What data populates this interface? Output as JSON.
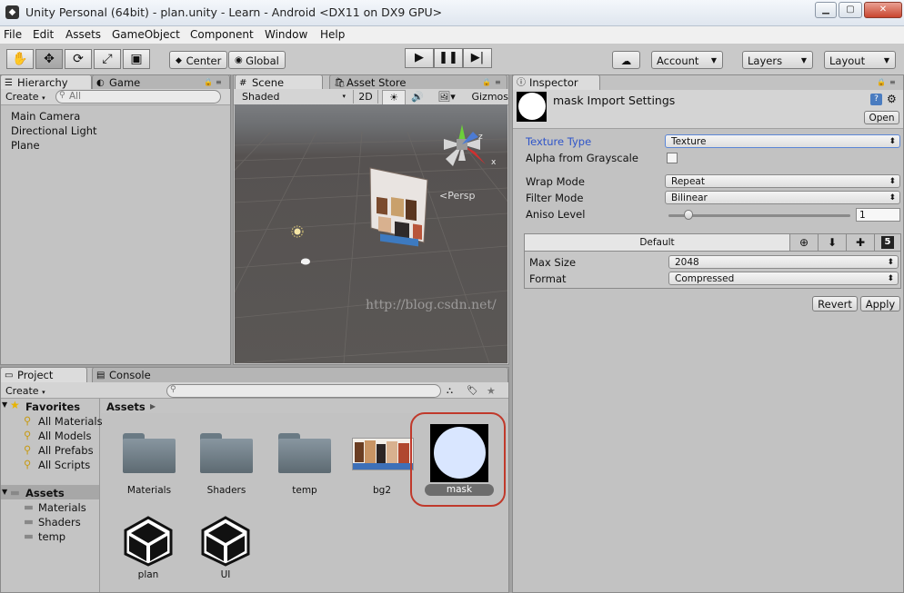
{
  "window": {
    "title": "Unity Personal (64bit) - plan.unity - Learn - Android <DX11 on DX9 GPU>"
  },
  "menu": [
    "File",
    "Edit",
    "Assets",
    "GameObject",
    "Component",
    "Window",
    "Help"
  ],
  "toolbar": {
    "pivot_label": "Center",
    "space_label": "Global",
    "account_label": "Account",
    "layers_label": "Layers",
    "layout_label": "Layout"
  },
  "hierarchy": {
    "tab": "Hierarchy",
    "create_label": "Create",
    "search_placeholder": "All",
    "items": [
      "Main Camera",
      "Directional Light",
      "Plane"
    ]
  },
  "scene": {
    "tabs": [
      "Scene",
      "Game",
      "Asset Store"
    ],
    "shading_mode": "Shaded",
    "mode_2d": "2D",
    "gizmos_label": "Gizmos",
    "persp_label": "Persp",
    "axis_labels": {
      "z": "z",
      "x": "x"
    },
    "watermark": "http://blog.csdn.net/"
  },
  "project": {
    "tabs": [
      "Project",
      "Console"
    ],
    "create_label": "Create",
    "favorites_label": "Favorites",
    "favorites": [
      "All Materials",
      "All Models",
      "All Prefabs",
      "All Scripts"
    ],
    "assets_root": "Assets",
    "asset_folders": [
      "Materials",
      "Shaders",
      "temp"
    ],
    "breadcrumb": "Assets",
    "grid": [
      {
        "name": "Materials",
        "kind": "folder"
      },
      {
        "name": "Shaders",
        "kind": "folder"
      },
      {
        "name": "temp",
        "kind": "folder"
      },
      {
        "name": "bg2",
        "kind": "image"
      },
      {
        "name": "mask",
        "kind": "texture",
        "selected": true
      },
      {
        "name": "plan",
        "kind": "unity-scene"
      },
      {
        "name": "UI",
        "kind": "unity-scene"
      }
    ]
  },
  "inspector": {
    "tab": "Inspector",
    "header_title": "mask Import Settings",
    "open_label": "Open",
    "texture_type_label": "Texture Type",
    "texture_type_value": "Texture",
    "alpha_label": "Alpha from Grayscale",
    "wrap_label": "Wrap Mode",
    "wrap_value": "Repeat",
    "filter_label": "Filter Mode",
    "filter_value": "Bilinear",
    "aniso_label": "Aniso Level",
    "aniso_value": "1",
    "aniso_level": 1,
    "platform_default_label": "Default",
    "max_size_label": "Max Size",
    "max_size_value": "2048",
    "format_label": "Format",
    "format_value": "Compressed",
    "revert_label": "Revert",
    "apply_label": "Apply"
  },
  "colors": {
    "accent_blue": "#2f55c9",
    "selection_ring": "#c0392b",
    "panel_bg": "#c2c2c2",
    "scene_bg": "#5c5856"
  }
}
